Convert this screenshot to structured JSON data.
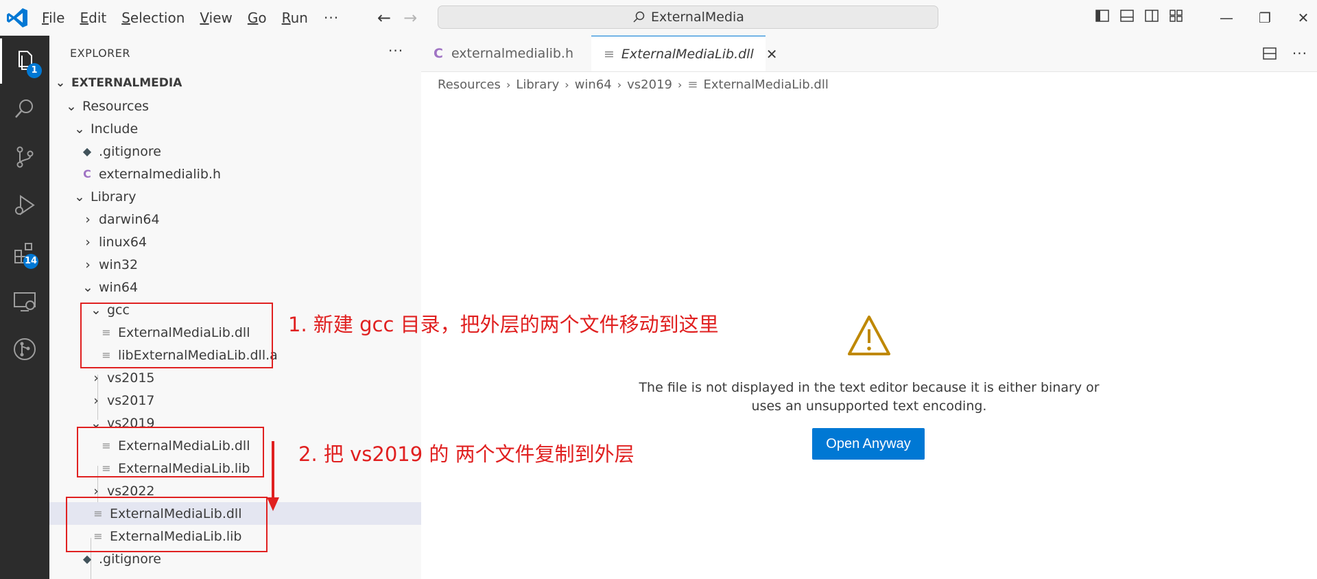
{
  "menu": {
    "items": [
      {
        "key": "F",
        "rest": "ile"
      },
      {
        "key": "E",
        "rest": "dit"
      },
      {
        "key": "S",
        "rest": "election"
      },
      {
        "key": "V",
        "rest": "iew"
      },
      {
        "key": "G",
        "rest": "o"
      },
      {
        "key": "R",
        "rest": "un"
      }
    ],
    "more": "···"
  },
  "command_center": {
    "text": "ExternalMedia",
    "icon": "search-icon"
  },
  "activity_bar": {
    "explorer_badge": "1",
    "extensions_badge": "14"
  },
  "explorer": {
    "title": "EXPLORER",
    "more": "···",
    "tree": [
      {
        "label": "EXTERNALMEDIA",
        "type": "root"
      },
      {
        "label": "Resources",
        "type": "folder-open"
      },
      {
        "label": "Include",
        "type": "folder-open"
      },
      {
        "label": ".gitignore",
        "type": "git"
      },
      {
        "label": "externalmedialib.h",
        "type": "c"
      },
      {
        "label": "Library",
        "type": "folder-open"
      },
      {
        "label": "darwin64",
        "type": "folder-closed"
      },
      {
        "label": "linux64",
        "type": "folder-closed"
      },
      {
        "label": "win32",
        "type": "folder-closed"
      },
      {
        "label": "win64",
        "type": "folder-open"
      },
      {
        "label": "gcc",
        "type": "folder-open"
      },
      {
        "label": "ExternalMediaLib.dll",
        "type": "file"
      },
      {
        "label": "libExternalMediaLib.dll.a",
        "type": "file"
      },
      {
        "label": "vs2015",
        "type": "folder-closed"
      },
      {
        "label": "vs2017",
        "type": "folder-closed"
      },
      {
        "label": "vs2019",
        "type": "folder-open"
      },
      {
        "label": "ExternalMediaLib.dll",
        "type": "file"
      },
      {
        "label": "ExternalMediaLib.lib",
        "type": "file"
      },
      {
        "label": "vs2022",
        "type": "folder-closed"
      },
      {
        "label": "ExternalMediaLib.dll",
        "type": "file"
      },
      {
        "label": "ExternalMediaLib.lib",
        "type": "file"
      },
      {
        "label": ".gitignore",
        "type": "git"
      }
    ]
  },
  "tabs": [
    {
      "label": "externalmedialib.h",
      "icon": "C",
      "modified": true
    },
    {
      "label": "ExternalMediaLib.dll",
      "active": true
    }
  ],
  "breadcrumb": [
    "Resources",
    "Library",
    "win64",
    "vs2019",
    "ExternalMediaLib.dll"
  ],
  "binary_notice": {
    "line1": "The file is not displayed in the text editor because it is either binary or",
    "line2": "uses an unsupported text encoding.",
    "button": "Open Anyway"
  },
  "annotations": {
    "note1": "1. 新建 gcc 目录，把外层的两个文件移动到这里",
    "note2": "2. 把 vs2019 的 两个文件复制到外层"
  },
  "colors": {
    "accent": "#0078d4",
    "annotation": "#e02020",
    "warning": "#bf8803"
  }
}
